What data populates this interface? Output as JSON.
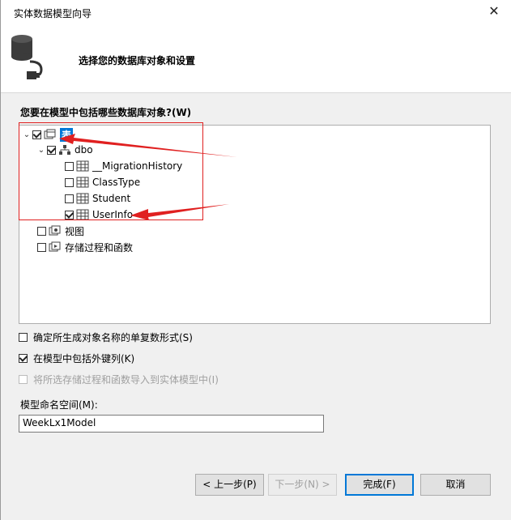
{
  "window": {
    "title": "实体数据模型向导",
    "close_label": "✕"
  },
  "header": {
    "subtitle": "选择您的数据库对象和设置"
  },
  "tree_prompt": "您要在模型中包括哪些数据库对象?(W)",
  "tree": {
    "tables_label": "表",
    "schema_label": "dbo",
    "tables": [
      {
        "label": "__MigrationHistory",
        "checked": false
      },
      {
        "label": "ClassType",
        "checked": false
      },
      {
        "label": "Student",
        "checked": false
      },
      {
        "label": "UserInfo",
        "checked": true
      }
    ],
    "views_label": "视图",
    "procs_label": "存储过程和函数"
  },
  "options": {
    "pluralize": {
      "label": "确定所生成对象名称的单复数形式(S)",
      "checked": false
    },
    "foreign_keys": {
      "label": "在模型中包括外键列(K)",
      "checked": true
    },
    "import_procs": {
      "label": "将所选存储过程和函数导入到实体模型中(I)",
      "checked": false,
      "disabled": true
    }
  },
  "namespace": {
    "label": "模型命名空间(M):",
    "value": "WeekLx1Model"
  },
  "buttons": {
    "back": "< 上一步(P)",
    "next": "下一步(N) >",
    "finish": "完成(F)",
    "cancel": "取消"
  },
  "colors": {
    "selection": "#0078d7",
    "annotation": "#e02020"
  }
}
